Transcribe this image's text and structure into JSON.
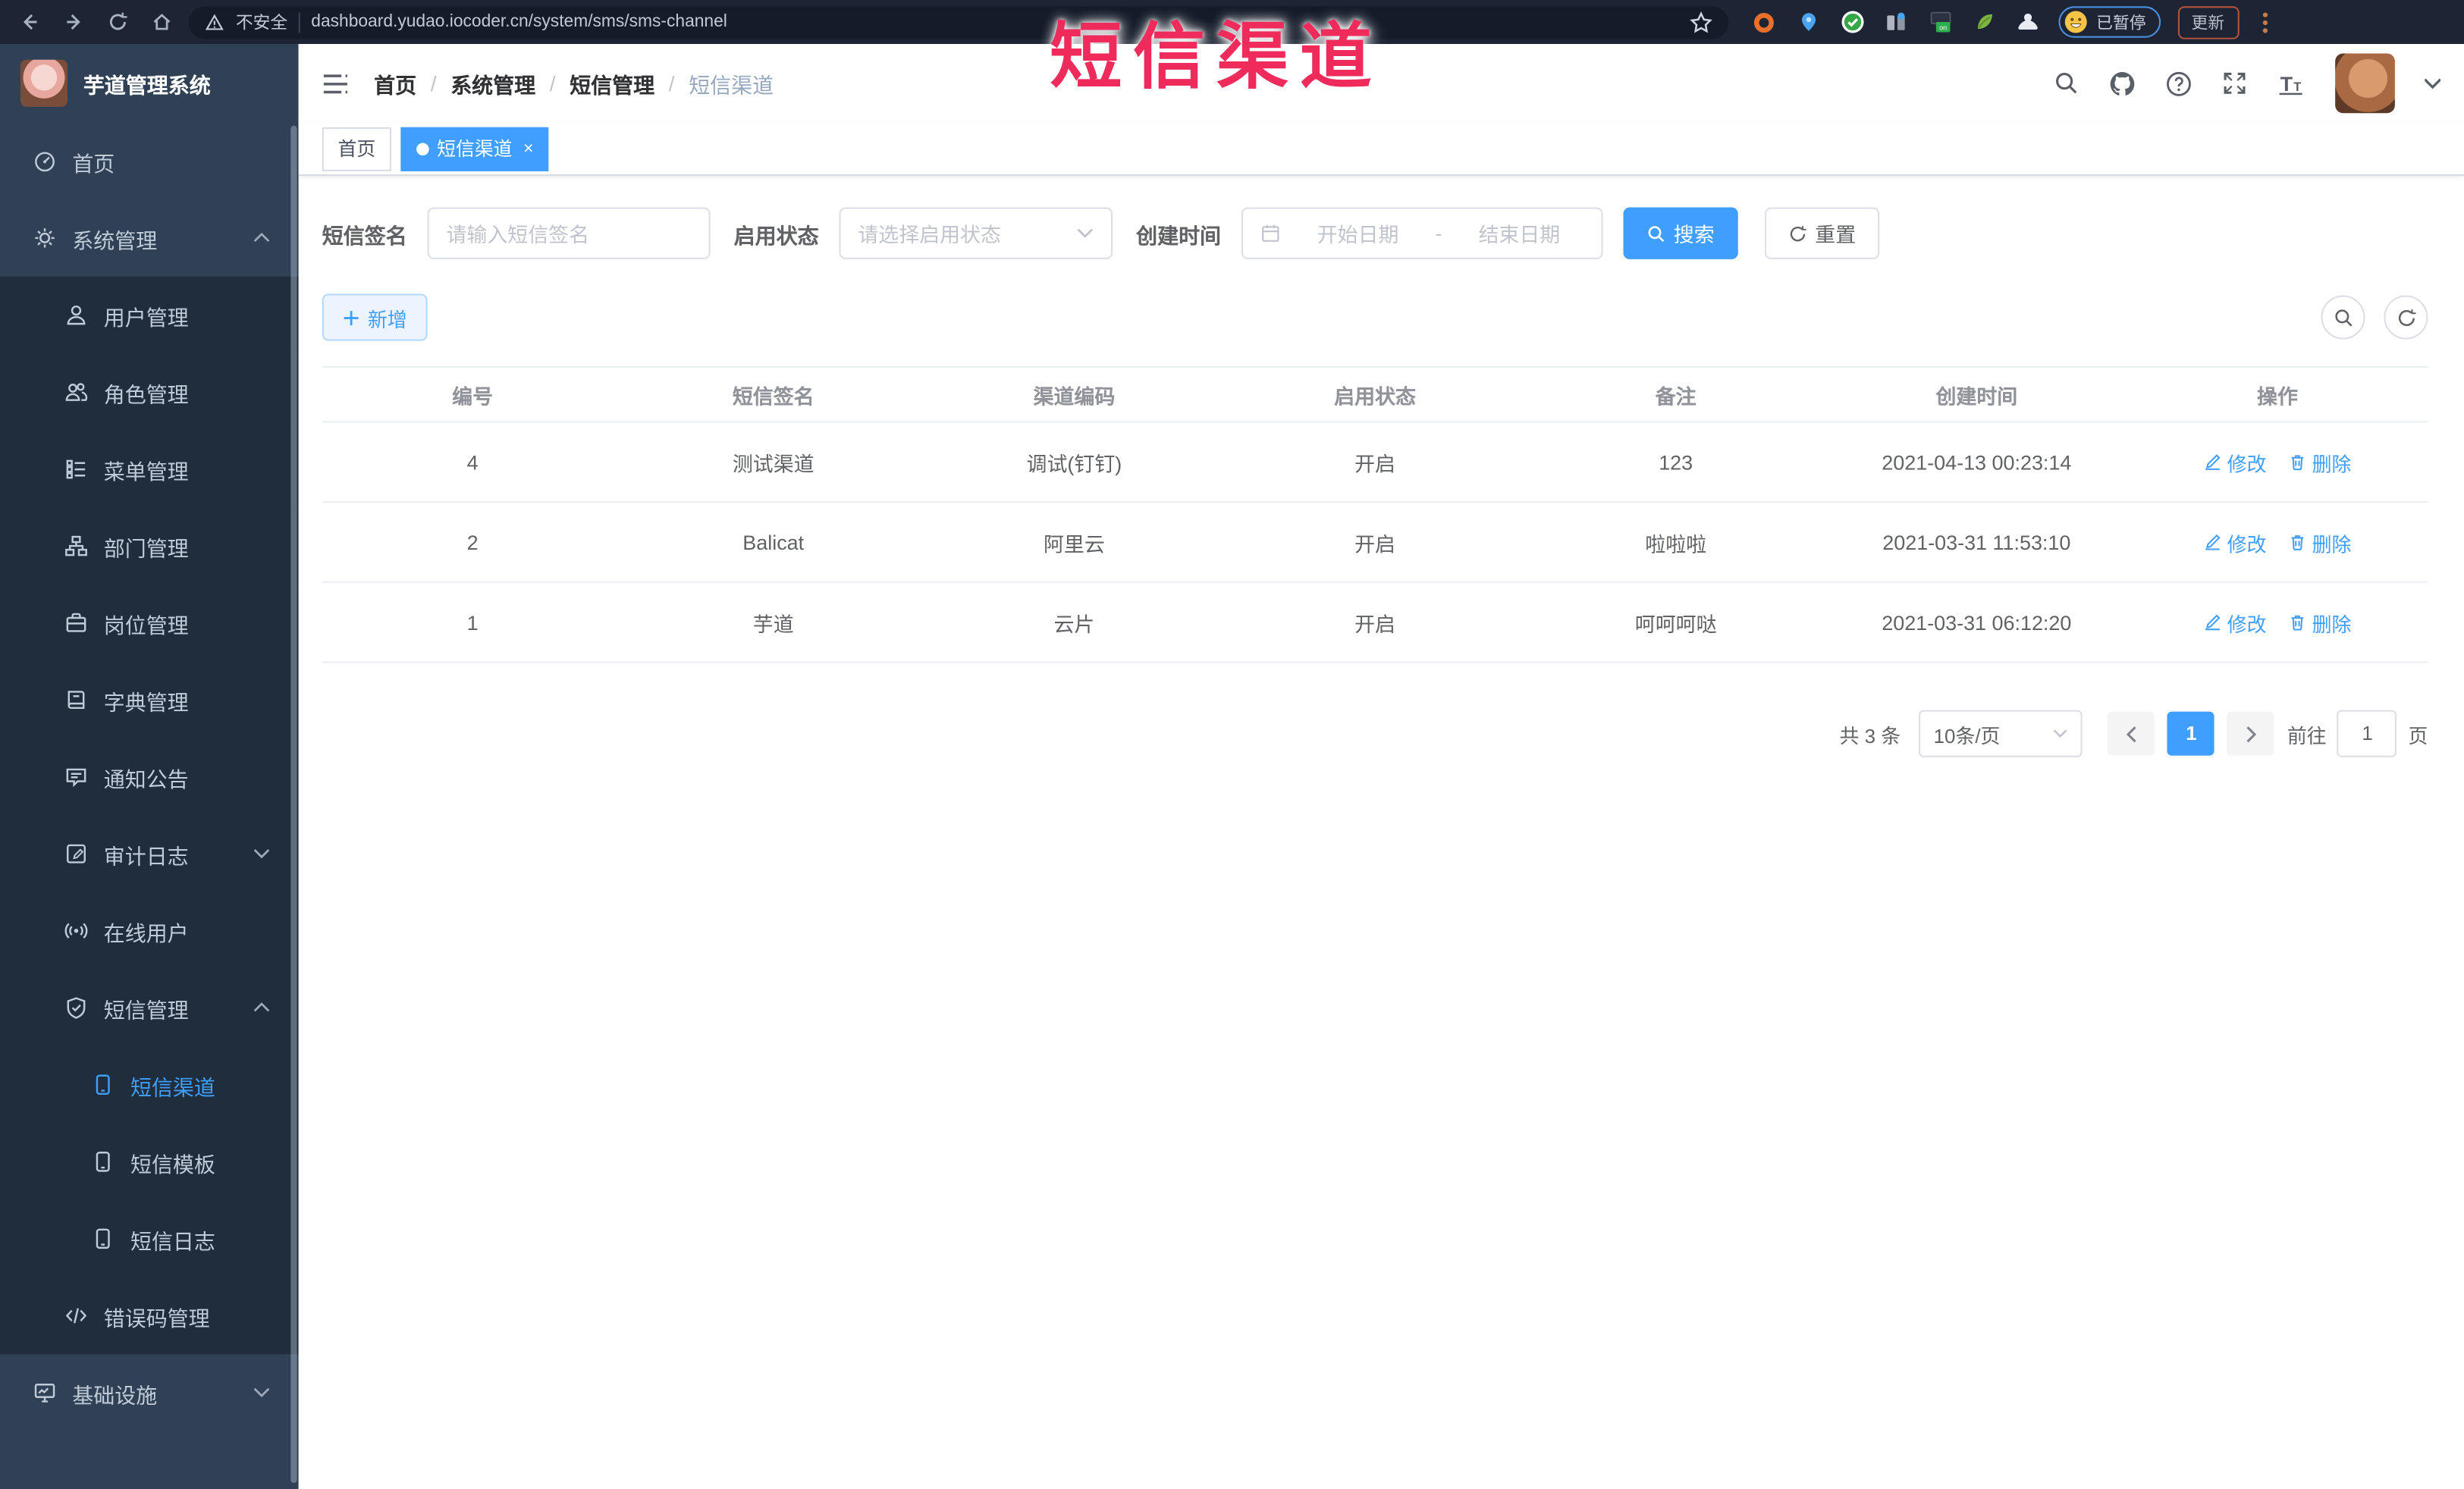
{
  "colors": {
    "accent": "#409eff",
    "annotation_red": "#ee2b5b",
    "sidebar_bg": "#304156",
    "submenu_bg": "#1f2d3d"
  },
  "browser": {
    "security_label": "不安全",
    "url": "dashboard.yudao.iocoder.cn/system/sms/sms-channel",
    "paused_badge": "已暂停",
    "update_button": "更新"
  },
  "annotation": {
    "text": "短信渠道"
  },
  "sidebar": {
    "title": "芋道管理系统",
    "items": [
      {
        "label": "首页",
        "icon": "dashboard-icon",
        "level": 1
      },
      {
        "label": "系统管理",
        "icon": "gear-icon",
        "level": 1,
        "chevron": "up"
      },
      {
        "label": "用户管理",
        "icon": "user-icon",
        "level": 2
      },
      {
        "label": "角色管理",
        "icon": "roles-icon",
        "level": 2
      },
      {
        "label": "菜单管理",
        "icon": "menu-list-icon",
        "level": 2
      },
      {
        "label": "部门管理",
        "icon": "org-tree-icon",
        "level": 2
      },
      {
        "label": "岗位管理",
        "icon": "post-icon",
        "level": 2
      },
      {
        "label": "字典管理",
        "icon": "dict-icon",
        "level": 2
      },
      {
        "label": "通知公告",
        "icon": "announcement-icon",
        "level": 2
      },
      {
        "label": "审计日志",
        "icon": "audit-log-icon",
        "level": 2,
        "chevron": "down"
      },
      {
        "label": "在线用户",
        "icon": "online-user-icon",
        "level": 2
      },
      {
        "label": "短信管理",
        "icon": "sms-icon",
        "level": 2,
        "chevron": "up"
      },
      {
        "label": "短信渠道",
        "icon": "phone-icon",
        "level": 3,
        "active": true
      },
      {
        "label": "短信模板",
        "icon": "phone-icon",
        "level": 3
      },
      {
        "label": "短信日志",
        "icon": "phone-icon",
        "level": 3
      },
      {
        "label": "错误码管理",
        "icon": "code-icon",
        "level": 2
      },
      {
        "label": "基础设施",
        "icon": "infra-icon",
        "level": 1,
        "chevron": "down"
      }
    ]
  },
  "navbar": {
    "breadcrumbs": [
      {
        "label": "首页",
        "current": false
      },
      {
        "label": "系统管理",
        "current": false
      },
      {
        "label": "短信管理",
        "current": false
      },
      {
        "label": "短信渠道",
        "current": true
      }
    ]
  },
  "tabs": [
    {
      "label": "首页",
      "active": false,
      "closable": false
    },
    {
      "label": "短信渠道",
      "active": true,
      "closable": true
    }
  ],
  "filters": {
    "signature_label": "短信签名",
    "signature_placeholder": "请输入短信签名",
    "status_label": "启用状态",
    "status_placeholder": "请选择启用状态",
    "created_label": "创建时间",
    "date_start_placeholder": "开始日期",
    "date_separator": "-",
    "date_end_placeholder": "结束日期",
    "search_label": "搜索",
    "reset_label": "重置"
  },
  "toolbar": {
    "add_label": "新增"
  },
  "table": {
    "columns": [
      "编号",
      "短信签名",
      "渠道编码",
      "启用状态",
      "备注",
      "创建时间",
      "操作"
    ],
    "rows": [
      {
        "id": "4",
        "signature": "测试渠道",
        "code": "调试(钉钉)",
        "status": "开启",
        "remark": "123",
        "created": "2021-04-13 00:23:14"
      },
      {
        "id": "2",
        "signature": "Balicat",
        "code": "阿里云",
        "status": "开启",
        "remark": "啦啦啦",
        "created": "2021-03-31 11:53:10"
      },
      {
        "id": "1",
        "signature": "芋道",
        "code": "云片",
        "status": "开启",
        "remark": "呵呵呵哒",
        "created": "2021-03-31 06:12:20"
      }
    ],
    "edit_label": "修改",
    "delete_label": "删除"
  },
  "pagination": {
    "total_label": "共 3 条",
    "page_size": "10条/页",
    "current_page": "1",
    "goto_label": "前往",
    "goto_value": "1",
    "page_label": "页"
  }
}
